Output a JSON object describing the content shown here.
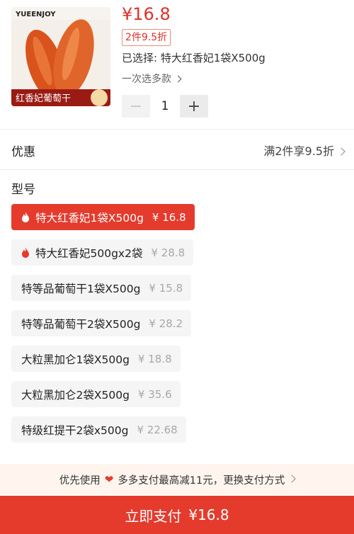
{
  "product": {
    "price": "¥16.8",
    "promo_tag": "2件9.5折",
    "selected_label": "已选择: 特大红香妃1袋X500g",
    "multi_select_label": "一次选多款",
    "quantity": "1",
    "image_brand": "YUEENJOY",
    "image_caption": "红香妃葡萄干"
  },
  "discount": {
    "label": "优惠",
    "value": "满2件享9.5折"
  },
  "model_section": {
    "title": "型号",
    "options": [
      {
        "label": "特大红香妃1袋X500g",
        "price": "¥ 16.8",
        "hot": true,
        "selected": true
      },
      {
        "label": "特大红香妃500gx2袋",
        "price": "¥ 28.8",
        "hot": true,
        "selected": false
      },
      {
        "label": "特等品葡萄干1袋X500g",
        "price": "¥ 15.8",
        "hot": false,
        "selected": false
      },
      {
        "label": "特等品葡萄干2袋X500g",
        "price": "¥ 28.2",
        "hot": false,
        "selected": false
      },
      {
        "label": "大粒黑加仑1袋X500g",
        "price": "¥ 18.8",
        "hot": false,
        "selected": false
      },
      {
        "label": "大粒黑加仑2袋X500g",
        "price": "¥ 35.6",
        "hot": false,
        "selected": false
      },
      {
        "label": "特级红提干2袋x500g",
        "price": "¥ 22.68",
        "hot": false,
        "selected": false
      }
    ]
  },
  "payment_hint": {
    "text_before": "优先使用",
    "text_after": "多多支付最高减11元，更换支付方式"
  },
  "pay_button": {
    "label": "立即支付",
    "amount": "¥16.8"
  },
  "colors": {
    "accent": "#e43b2d",
    "price": "#e0312a"
  }
}
